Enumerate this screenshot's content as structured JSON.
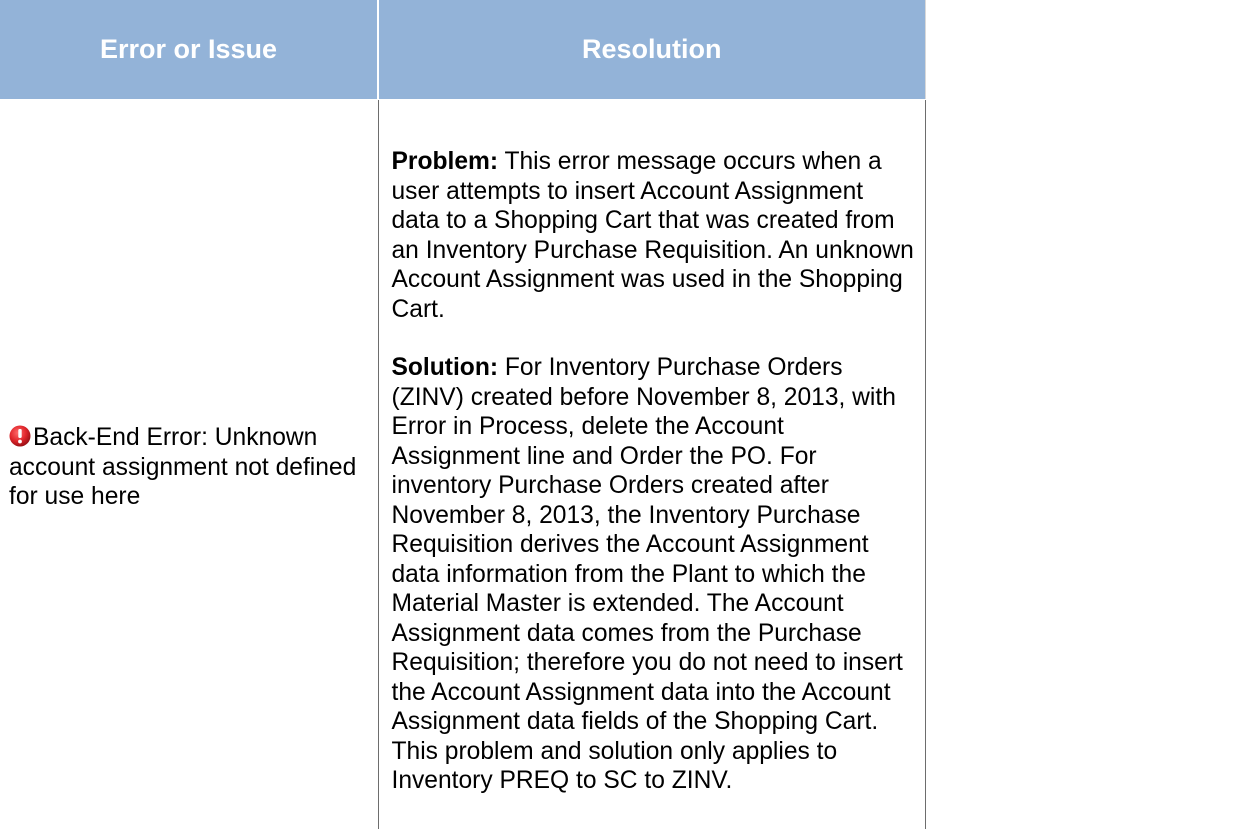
{
  "table": {
    "headers": {
      "issue": "Error or Issue",
      "resolution": "Resolution"
    },
    "row": {
      "issue": {
        "icon": "error-icon",
        "icon_color": "#e0262b",
        "text": "Back-End Error: Unknown account assignment not defined for use here"
      },
      "resolution": {
        "problem_label": "Problem:",
        "problem_text": " This error message occurs when a user attempts to insert Account Assignment data to a Shopping Cart that was created from an Inventory Purchase Requisition.  An unknown Account Assignment was used in the Shopping Cart.",
        "solution_label": "Solution:",
        "solution_text": " For Inventory Purchase Orders (ZINV) created before November 8, 2013, with Error in Process, delete the Account Assignment line and Order the PO. For inventory Purchase Orders created after November 8, 2013, the Inventory Purchase Requisition derives the Account Assignment data information from the Plant to which the Material Master is extended.  The Account Assignment data comes from the Purchase Requisition; therefore you do not need to insert the Account Assignment data into the Account Assignment data fields of the Shopping Cart. This problem and solution only applies to Inventory PREQ to SC to ZINV."
      }
    }
  },
  "colors": {
    "header_bg": "#93b3d8",
    "header_text": "#ffffff",
    "border": "#6d6d6d"
  }
}
